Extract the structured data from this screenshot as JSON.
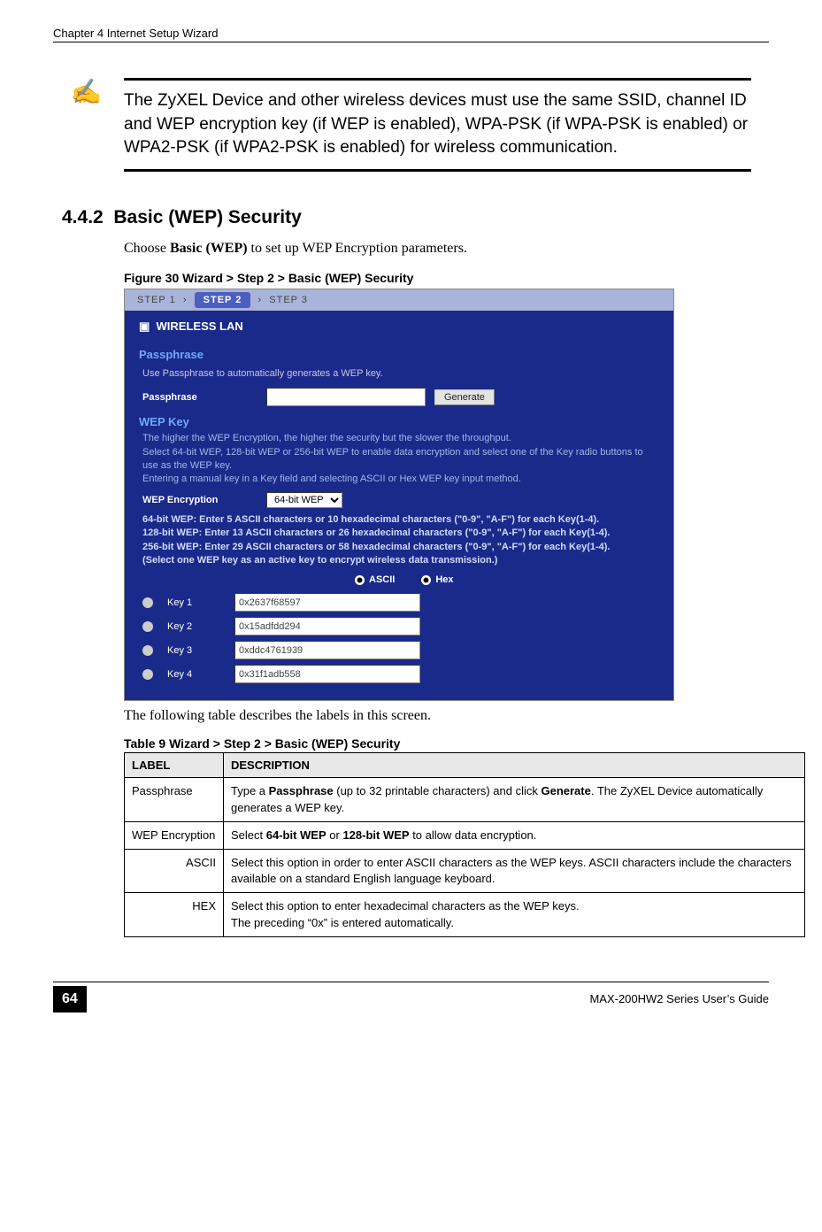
{
  "chapter_header": "Chapter 4 Internet Setup Wizard",
  "note": {
    "icon": "✍",
    "text": "The ZyXEL Device and other wireless devices must use the same SSID, channel ID and WEP encryption key (if WEP is enabled), WPA-PSK (if WPA-PSK is enabled) or WPA2-PSK (if WPA2-PSK is enabled) for wireless communication."
  },
  "section": {
    "number": "4.4.2",
    "title": "Basic (WEP) Security"
  },
  "intro_text_prefix": "Choose ",
  "intro_text_bold": "Basic (WEP)",
  "intro_text_suffix": " to set up WEP Encryption parameters.",
  "figure_caption": "Figure 30   Wizard > Step 2 > Basic (WEP) Security",
  "screenshot": {
    "steps": {
      "s1": "STEP 1",
      "s2": "STEP 2",
      "s3": "STEP 3",
      "sep": "›"
    },
    "wlan_title": "WIRELESS LAN",
    "passphrase_section": "Passphrase",
    "passphrase_hint": "Use Passphrase to automatically generates a WEP key.",
    "passphrase_label": "Passphrase",
    "generate_button": "Generate",
    "wepkey_section": "WEP Key",
    "wep_intro": "The higher the WEP Encryption, the higher the security but the slower the throughput.\nSelect 64-bit WEP, 128-bit WEP or 256-bit WEP to enable data encryption and select one of the Key radio buttons to use as the WEP key.\nEntering a manual key in a Key field and selecting ASCII or Hex WEP key input method.",
    "wep_encryption_label": "WEP Encryption",
    "wep_encryption_value": "64-bit WEP",
    "bits_hint": "64-bit WEP: Enter 5 ASCII characters or 10 hexadecimal characters (\"0-9\", \"A-F\") for each Key(1-4).\n128-bit WEP: Enter 13 ASCII characters or 26 hexadecimal characters (\"0-9\", \"A-F\") for each Key(1-4).\n256-bit WEP: Enter 29 ASCII characters or 58 hexadecimal characters (\"0-9\", \"A-F\") for each Key(1-4).\n(Select one WEP key as an active key to encrypt wireless data transmission.)",
    "ascii_label": "ASCII",
    "hex_label": "Hex",
    "keys": [
      {
        "label": "Key 1",
        "value": "0x2637f68597"
      },
      {
        "label": "Key 2",
        "value": "0x15adfdd294"
      },
      {
        "label": "Key 3",
        "value": "0xddc4761939"
      },
      {
        "label": "Key 4",
        "value": "0x31f1adb558"
      }
    ]
  },
  "post_figure_text": "The following table describes the labels in this screen.",
  "table_caption": "Table 9   Wizard > Step 2 > Basic (WEP) Security",
  "table": {
    "headers": {
      "label": "LABEL",
      "desc": "DESCRIPTION"
    },
    "rows": [
      {
        "label": "Passphrase",
        "desc_pre": "Type a ",
        "desc_b1": "Passphrase",
        "desc_mid": " (up to 32 printable characters) and click ",
        "desc_b2": "Generate",
        "desc_post": ". The ZyXEL Device automatically generates a WEP key."
      },
      {
        "label": "WEP Encryption",
        "desc_pre": "Select ",
        "desc_b1": "64-bit WEP",
        "desc_mid": " or ",
        "desc_b2": "128-bit WEP",
        "desc_post": " to allow data encryption."
      },
      {
        "label": "ASCII",
        "sub": true,
        "desc": "Select this option in order to enter ASCII characters as the WEP keys. ASCII characters include the characters available on a standard English language keyboard."
      },
      {
        "label": "HEX",
        "sub": true,
        "desc": "Select this option to enter hexadecimal characters as the WEP keys.\nThe preceding “0x” is entered automatically."
      }
    ]
  },
  "footer": {
    "page": "64",
    "guide": "MAX-200HW2 Series User’s Guide"
  }
}
